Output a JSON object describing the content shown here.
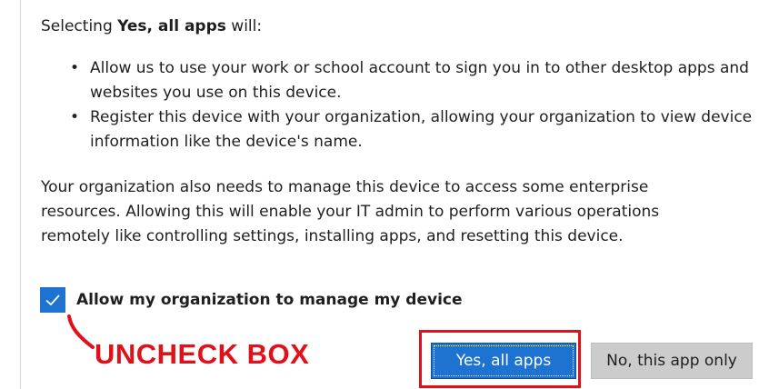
{
  "intro": {
    "prefix": "Selecting ",
    "emphasis": "Yes, all apps",
    "suffix": " will:"
  },
  "bullets": [
    {
      "text": "Allow us to use your work or school account to sign you in to other desktop apps and websites you use on this device."
    },
    {
      "text": "Register this device with your organization, allowing your organization to view device information like the device's name."
    }
  ],
  "paragraph": "Your organization also needs to manage this device to access some enterprise resources. Allowing this will enable your IT admin to perform various operations remotely like controlling settings, installing apps, and resetting this device.",
  "manage_checkbox": {
    "label": "Allow my organization to manage my device",
    "checked": true
  },
  "annotation": {
    "text": "UNCHECK BOX",
    "color": "#e0111b"
  },
  "buttons": {
    "primary_label": "Yes, all apps",
    "secondary_label": "No, this app only"
  },
  "colors": {
    "accent": "#1e72d0",
    "annotation_red": "#e0111b",
    "secondary_button": "#cccccc"
  },
  "icons": {
    "checkbox": "checkmark-icon",
    "annotation": "curved-arrow-icon"
  }
}
